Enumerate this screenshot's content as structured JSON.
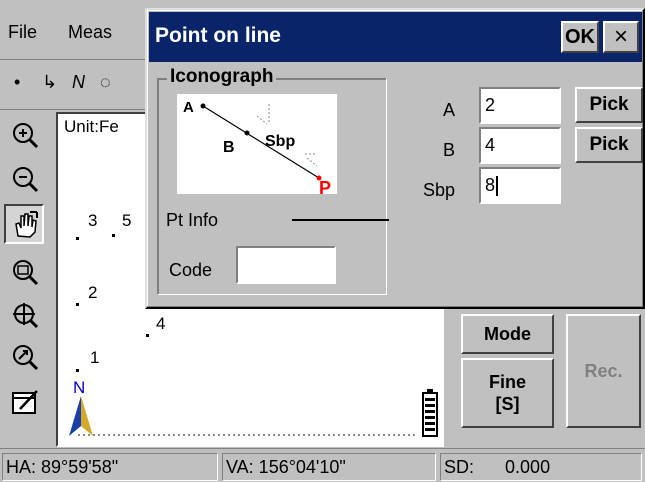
{
  "menubar": {
    "items": [
      "File",
      "Meas"
    ]
  },
  "toolbar": {
    "tools": [
      "•",
      "↳",
      "N",
      "◌"
    ]
  },
  "plot": {
    "unit_label": "Unit:Fe",
    "points": [
      {
        "label": "3"
      },
      {
        "label": "5"
      },
      {
        "label": "2"
      },
      {
        "label": "4"
      },
      {
        "label": "1"
      }
    ],
    "north_label": "N"
  },
  "side_tools": [
    "zoom-in-icon",
    "zoom-out-icon",
    "pan-hand-icon",
    "zoom-window-icon",
    "zoom-center-icon",
    "zoom-extent-icon",
    "draw-settings-icon"
  ],
  "right_panel": {
    "mode_label": "Mode",
    "fine_label": "Fine",
    "fine_sub": "[S]",
    "rec_label": "Rec."
  },
  "status": {
    "ha": "HA: 89°59'58\"",
    "va": "VA: 156°04'10\"",
    "sd_label": "SD:",
    "sd_value": "0.000"
  },
  "dialog": {
    "title": "Point on line",
    "ok_label": "OK",
    "close_label": "×",
    "iconograph": {
      "caption": "Iconograph",
      "labels": {
        "a": "A",
        "b": "B",
        "sbp": "Sbp",
        "p": "P"
      }
    },
    "pt_info": {
      "caption": "Pt Info",
      "code_label": "Code",
      "code_value": ""
    },
    "fields": [
      {
        "label": "A",
        "value": "2",
        "pick": "Pick"
      },
      {
        "label": "B",
        "value": "4",
        "pick": "Pick"
      },
      {
        "label": "Sbp",
        "value": "8"
      }
    ]
  },
  "colors": {
    "title_bar": "#0a246a",
    "face": "#c0c0c0",
    "p_point": "#ff0000",
    "north_arrow": "#0000cc"
  }
}
